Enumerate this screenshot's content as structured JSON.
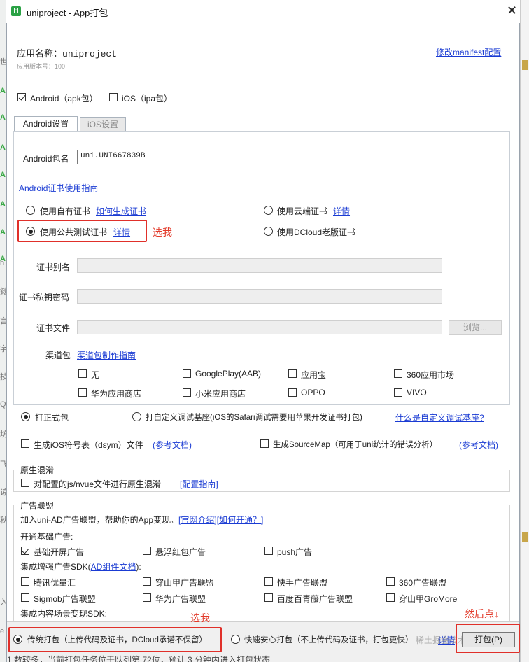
{
  "window": {
    "title": "uniproject - App打包",
    "icon": "hbuilder-logo-icon",
    "close": "close-icon"
  },
  "background": {
    "left_chars": [
      "世",
      "A",
      "A",
      "A",
      "A",
      "A",
      "A",
      "A",
      "n",
      "鍅",
      "言",
      "字",
      "技",
      "Q",
      "坊",
      "飞",
      "谅",
      "秋",
      "入",
      "e"
    ],
    "bottom_status": "1 数较多，当前打包任务位于队列第  72位，预计  3  分钟内进入打包状态"
  },
  "app": {
    "name_label": "应用名称：",
    "name_value": "uniproject",
    "version_label": "应用版本号：",
    "version_value": "100",
    "manifest_link": "修改manifest配置"
  },
  "platforms": {
    "android": "Android（apk包）",
    "ios": "iOS（ipa包）"
  },
  "tabs": {
    "android": "Android设置",
    "ios": "iOS设置"
  },
  "android": {
    "package_label": "Android包名",
    "package_value": "uni.UNI667839B",
    "cert_guide_link": "Android证书使用指南",
    "own_cert": "使用自有证书",
    "own_cert_link": "如何生成证书",
    "cloud_cert": "使用云端证书",
    "cloud_cert_link": "详情",
    "public_cert": "使用公共测试证书",
    "public_cert_link": "详情",
    "dcloud_old_cert": "使用DCloud老版证书",
    "alias_label": "证书别名",
    "password_label": "证书私钥密码",
    "file_label": "证书文件",
    "browse_label": "浏览...",
    "channel_label": "渠道包",
    "channel_link": "渠道包制作指南",
    "channels": [
      "无",
      "GooglePlay(AAB)",
      "应用宝",
      "360应用市场",
      "华为应用商店",
      "小米应用商店",
      "OPPO",
      "VIVO"
    ]
  },
  "annotations": {
    "choose_me_1": "选我",
    "choose_me_2": "选我",
    "then_click": "然后点↓"
  },
  "build_type": {
    "formal": "打正式包",
    "custom_base": "打自定义调试基座(iOS的Safari调试需要用苹果开发证书打包)",
    "custom_base_link": "什么是自定义调试基座?"
  },
  "options": {
    "dsym": "生成iOS符号表（dsym）文件",
    "dsym_link": "(参考文档)",
    "sourcemap": "生成SourceMap（可用于uni统计的错误分析）",
    "sourcemap_link": "(参考文档)"
  },
  "native_obfuscation": {
    "title": "原生混淆",
    "checkbox": "对配置的js/nvue文件进行原生混淆",
    "link": "[配置指南]"
  },
  "ads": {
    "title": "广告联盟",
    "intro": "加入uni-AD广告联盟，帮助你的App变现。",
    "intro_link1": "[官网介绍]",
    "intro_link2": "[如何开通？]",
    "basic_title": "开通基础广告:",
    "basic": [
      "基础开屏广告",
      "悬浮红包广告",
      "push广告"
    ],
    "sdk_title_prefix": "集成增强广告SDK(",
    "sdk_title_link": "AD组件文档",
    "sdk_title_suffix": "):",
    "sdk": [
      "腾讯优量汇",
      "穿山甲广告联盟",
      "快手广告联盟",
      "360广告联盟",
      "Sigmob广告联盟",
      "华为广告联盟",
      "百度百青藤广告联盟",
      "穿山甲GroMore"
    ],
    "content_title": "集成内容场景变现SDK:"
  },
  "bottom": {
    "traditional": "传统打包（上传代码及证书，DCloud承诺不保留）",
    "safe": "快速安心打包（不上传代码及证书，打包更快）",
    "safe_link": "详情",
    "watermark": "稀土掘金技术社区",
    "pack_button": "打包(P)"
  }
}
